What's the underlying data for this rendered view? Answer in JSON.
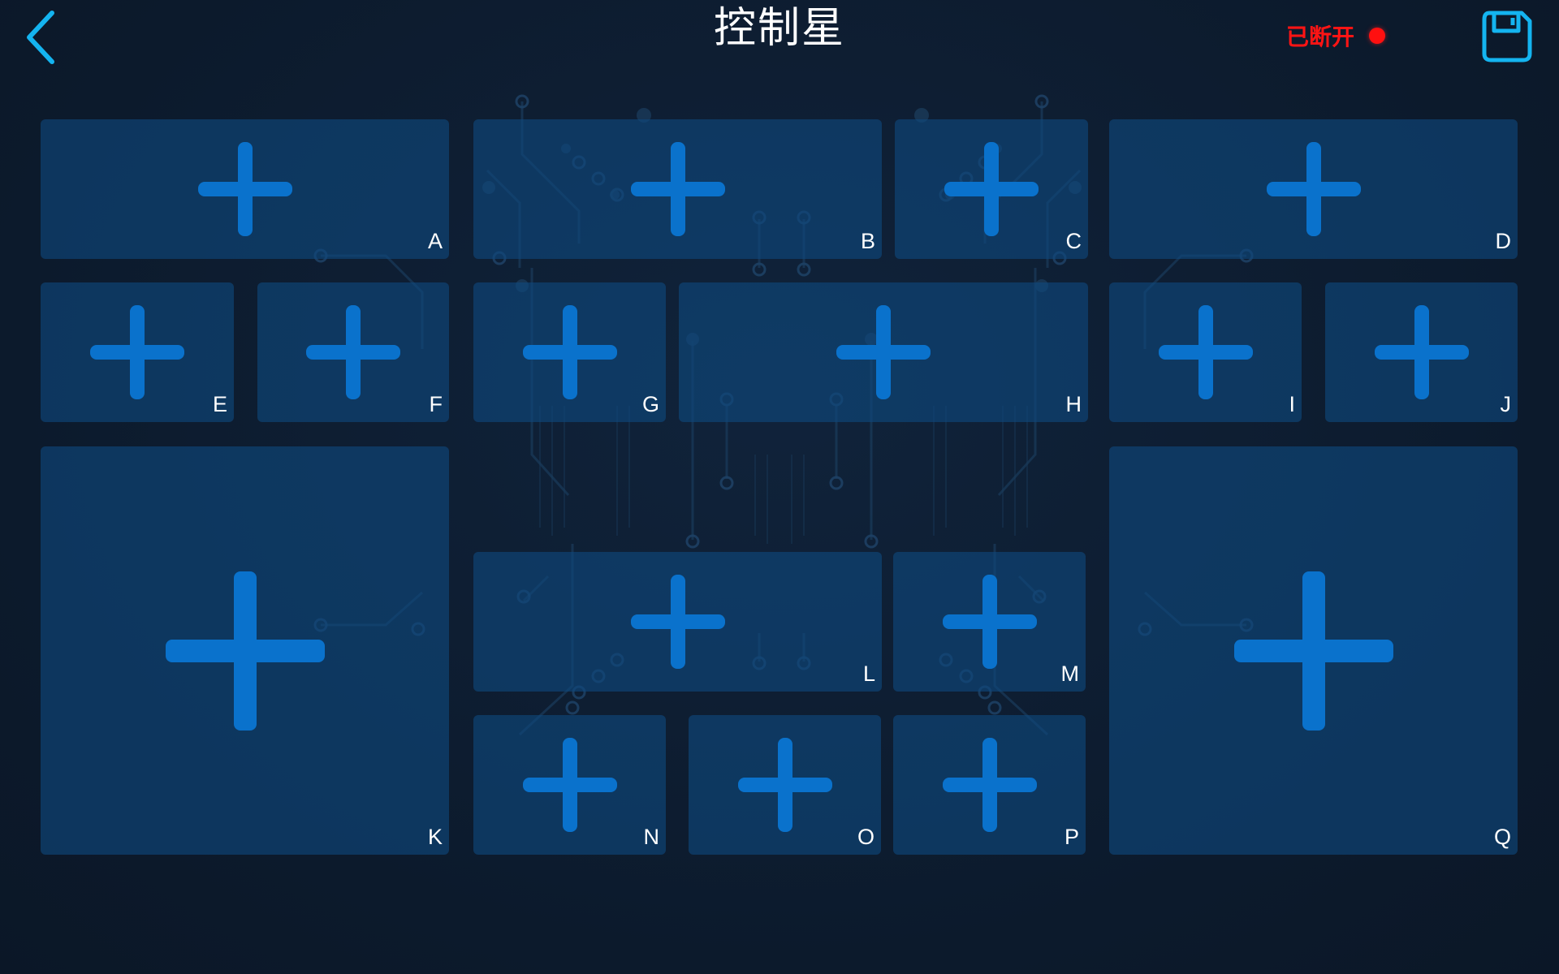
{
  "header": {
    "title": "控制星",
    "status_text": "已断开",
    "status_color": "#ff1414",
    "back_icon": "chevron-left-icon",
    "save_icon": "floppy-disk-icon",
    "accent_color": "#14b4f0"
  },
  "slots": {
    "A": {
      "label": "A",
      "icon": "plus-icon"
    },
    "B": {
      "label": "B",
      "icon": "plus-icon"
    },
    "C": {
      "label": "C",
      "icon": "plus-icon"
    },
    "D": {
      "label": "D",
      "icon": "plus-icon"
    },
    "E": {
      "label": "E",
      "icon": "plus-icon"
    },
    "F": {
      "label": "F",
      "icon": "plus-icon"
    },
    "G": {
      "label": "G",
      "icon": "plus-icon"
    },
    "H": {
      "label": "H",
      "icon": "plus-icon"
    },
    "I": {
      "label": "I",
      "icon": "plus-icon"
    },
    "J": {
      "label": "J",
      "icon": "plus-icon"
    },
    "K": {
      "label": "K",
      "icon": "plus-icon"
    },
    "L": {
      "label": "L",
      "icon": "plus-icon"
    },
    "M": {
      "label": "M",
      "icon": "plus-icon"
    },
    "N": {
      "label": "N",
      "icon": "plus-icon"
    },
    "O": {
      "label": "O",
      "icon": "plus-icon"
    },
    "P": {
      "label": "P",
      "icon": "plus-icon"
    },
    "Q": {
      "label": "Q",
      "icon": "plus-icon"
    }
  }
}
